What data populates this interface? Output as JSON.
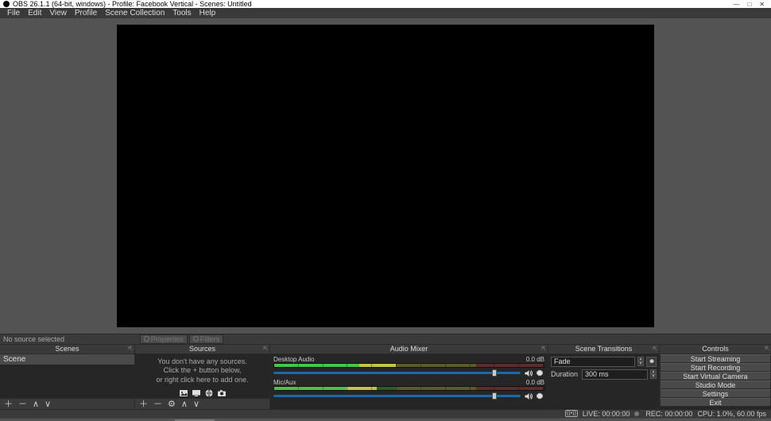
{
  "window": {
    "title": "OBS 26.1.1 (64-bit, windows) - Profile: Facebook Vertical - Scenes: Untitled",
    "min": "—",
    "max": "□",
    "close": "✕"
  },
  "menu": [
    "File",
    "Edit",
    "View",
    "Profile",
    "Scene Collection",
    "Tools",
    "Help"
  ],
  "source_bar": {
    "no_source": "No source selected",
    "properties": "Properties",
    "filters": "Filters"
  },
  "docks": {
    "scenes": {
      "title": "Scenes",
      "items": [
        "Scene"
      ]
    },
    "sources": {
      "title": "Sources",
      "empty1": "You don't have any sources.",
      "empty2": "Click the + button below,",
      "empty3": "or right click here to add one."
    },
    "mixer": {
      "title": "Audio Mixer",
      "channels": [
        {
          "name": "Desktop Audio",
          "level": "0.0 dB"
        },
        {
          "name": "Mic/Aux",
          "level": "0.0 dB"
        }
      ]
    },
    "transitions": {
      "title": "Scene Transitions",
      "type": "Fade",
      "duration_label": "Duration",
      "duration_value": "300 ms"
    },
    "controls": {
      "title": "Controls",
      "buttons": [
        "Start Streaming",
        "Start Recording",
        "Start Virtual Camera",
        "Studio Mode",
        "Settings",
        "Exit"
      ]
    }
  },
  "status": {
    "live_label": "LIVE:",
    "live_time": "00:00:00",
    "rec_label": "REC:",
    "rec_time": "00:00:00",
    "cpu": "CPU: 1.0%, 60.00 fps"
  }
}
